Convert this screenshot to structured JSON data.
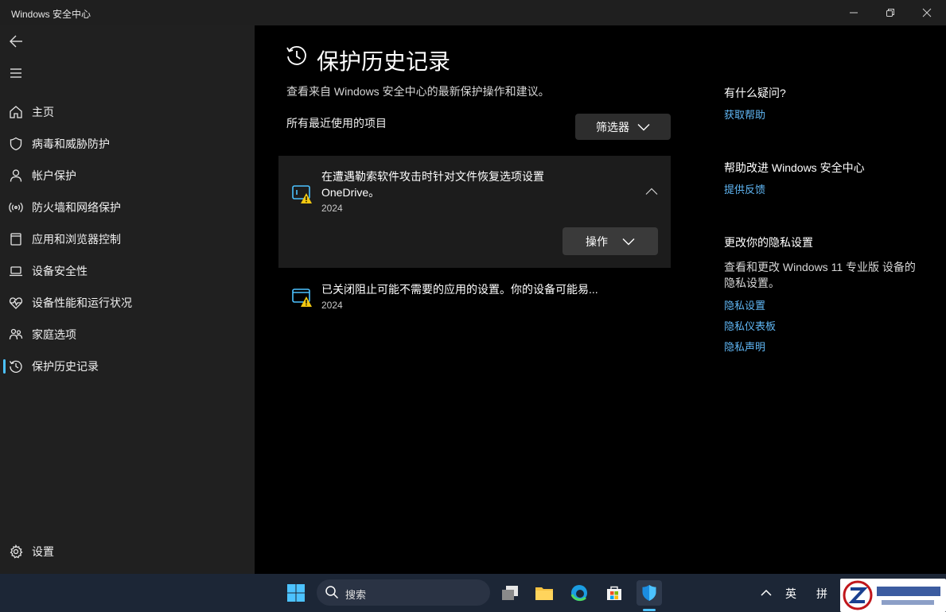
{
  "window": {
    "title": "Windows 安全中心"
  },
  "sidebar": {
    "items": [
      {
        "label": "主页",
        "icon": "home-icon"
      },
      {
        "label": "病毒和威胁防护",
        "icon": "shield-icon"
      },
      {
        "label": "帐户保护",
        "icon": "person-icon"
      },
      {
        "label": "防火墙和网络保护",
        "icon": "wifi-icon"
      },
      {
        "label": "应用和浏览器控制",
        "icon": "app-window-icon"
      },
      {
        "label": "设备安全性",
        "icon": "laptop-icon"
      },
      {
        "label": "设备性能和运行状况",
        "icon": "heart-pulse-icon"
      },
      {
        "label": "家庭选项",
        "icon": "family-icon"
      },
      {
        "label": "保护历史记录",
        "icon": "history-icon",
        "active": true
      }
    ],
    "settings_label": "设置"
  },
  "main": {
    "title": "保护历史记录",
    "subtitle": "查看来自 Windows 安全中心的最新保护操作和建议。",
    "recent_label": "所有最近使用的项目",
    "filter_label": "筛选器",
    "items": [
      {
        "title_line1": "在遭遇勒索软件攻击时针对文件恢复选项设置",
        "title_line2": "OneDrive。",
        "year": "2024",
        "action_label": "操作",
        "expanded": true
      },
      {
        "title_line1": "已关闭阻止可能不需要的应用的设置。你的设备可能易...",
        "year": "2024",
        "expanded": false
      }
    ]
  },
  "right": {
    "question_heading": "有什么疑问?",
    "get_help": "获取帮助",
    "improve_heading": "帮助改进 Windows 安全中心",
    "feedback": "提供反馈",
    "privacy_heading": "更改你的隐私设置",
    "privacy_text": "查看和更改 Windows 11 专业版 设备的隐私设置。",
    "privacy_links": [
      "隐私设置",
      "隐私仪表板",
      "隐私声明"
    ]
  },
  "taskbar": {
    "search_placeholder": "搜索",
    "tray_lang": "英",
    "tray_ime": "拼"
  },
  "colors": {
    "accent": "#4cc2ff",
    "link": "#60b7f5",
    "warning": "#f2c811",
    "sidebar_bg": "#202020",
    "taskbar_bg": "#1c2636"
  }
}
